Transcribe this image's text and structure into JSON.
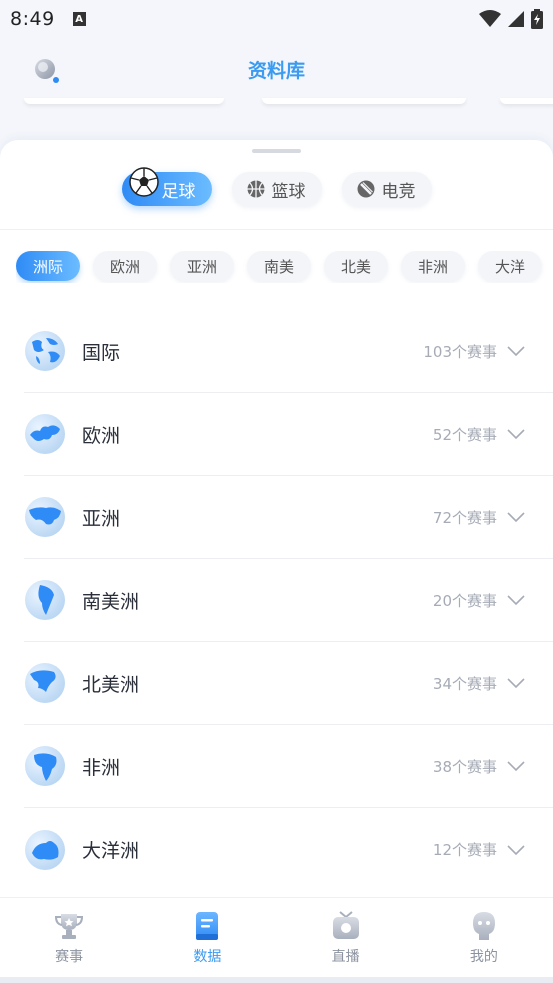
{
  "status_bar": {
    "time": "8:49",
    "notification_icon": "A"
  },
  "header": {
    "title": "资料库",
    "search_icon": "search-icon"
  },
  "sport_tabs": [
    {
      "label": "足球",
      "icon": "soccer-ball-icon",
      "active": true
    },
    {
      "label": "篮球",
      "icon": "basketball-icon",
      "active": false
    },
    {
      "label": "电竞",
      "icon": "esports-icon",
      "active": false
    }
  ],
  "region_tabs": [
    {
      "label": "洲际",
      "active": true
    },
    {
      "label": "欧洲",
      "active": false
    },
    {
      "label": "亚洲",
      "active": false
    },
    {
      "label": "南美",
      "active": false
    },
    {
      "label": "北美",
      "active": false
    },
    {
      "label": "非洲",
      "active": false
    },
    {
      "label": "大洋",
      "active": false
    }
  ],
  "regions": [
    {
      "name": "国际",
      "count": "103个赛事",
      "icon": "globe-world-icon"
    },
    {
      "name": "欧洲",
      "count": "52个赛事",
      "icon": "globe-europe-icon"
    },
    {
      "name": "亚洲",
      "count": "72个赛事",
      "icon": "globe-asia-icon"
    },
    {
      "name": "南美洲",
      "count": "20个赛事",
      "icon": "globe-south-america-icon"
    },
    {
      "name": "北美洲",
      "count": "34个赛事",
      "icon": "globe-north-america-icon"
    },
    {
      "name": "非洲",
      "count": "38个赛事",
      "icon": "globe-africa-icon"
    },
    {
      "name": "大洋洲",
      "count": "12个赛事",
      "icon": "globe-oceania-icon"
    }
  ],
  "tabbar": [
    {
      "label": "赛事",
      "icon": "trophy-icon",
      "active": false
    },
    {
      "label": "数据",
      "icon": "book-icon",
      "active": true
    },
    {
      "label": "直播",
      "icon": "tv-icon",
      "active": false
    },
    {
      "label": "我的",
      "icon": "profile-icon",
      "active": false
    }
  ],
  "colors": {
    "accent": "#3a9bf0",
    "muted": "#a6abb6",
    "text": "#2a2f3a"
  }
}
